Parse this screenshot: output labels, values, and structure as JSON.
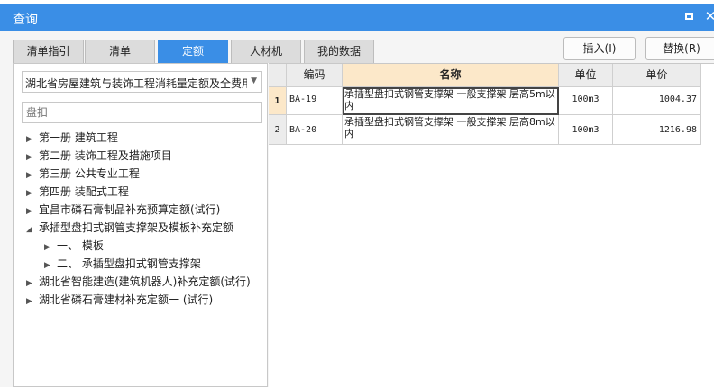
{
  "window": {
    "title": "查询",
    "maximize_label": "□",
    "close_label": "✕"
  },
  "tabs": [
    {
      "label": "清单指引",
      "active": false
    },
    {
      "label": "清单",
      "active": false
    },
    {
      "label": "定额",
      "active": true
    },
    {
      "label": "人材机",
      "active": false
    },
    {
      "label": "我的数据",
      "active": false
    }
  ],
  "actions": {
    "insert_label": "插入(I)",
    "replace_label": "替换(R)"
  },
  "left": {
    "library_select": "湖北省房屋建筑与装饰工程消耗量定额及全费用基价表",
    "search_placeholder": "盘扣",
    "tree": [
      {
        "label": "第一册 建筑工程",
        "expanded": false,
        "level": 0
      },
      {
        "label": "第二册 装饰工程及措施项目",
        "expanded": false,
        "level": 0
      },
      {
        "label": "第三册 公共专业工程",
        "expanded": false,
        "level": 0
      },
      {
        "label": "第四册 装配式工程",
        "expanded": false,
        "level": 0
      },
      {
        "label": "宜昌市磷石膏制品补充预算定额(试行)",
        "expanded": false,
        "level": 0
      },
      {
        "label": "承插型盘扣式钢管支撑架及模板补充定额",
        "expanded": true,
        "level": 0
      },
      {
        "label": "一、 模板",
        "expanded": false,
        "level": 1
      },
      {
        "label": "二、 承插型盘扣式钢管支撑架",
        "expanded": false,
        "level": 1
      },
      {
        "label": "湖北省智能建造(建筑机器人)补充定额(试行)",
        "expanded": false,
        "level": 0
      },
      {
        "label": "湖北省磷石膏建材补充定额一 (试行)",
        "expanded": false,
        "level": 0
      }
    ]
  },
  "grid": {
    "columns": {
      "code": "编码",
      "name": "名称",
      "unit": "单位",
      "price": "单价"
    },
    "rows": [
      {
        "num": "1",
        "code": "BA-19",
        "name": "承插型盘扣式钢管支撑架 一般支撑架 层高5m以内",
        "unit": "100m3",
        "price": "1004.37",
        "selected": true
      },
      {
        "num": "2",
        "code": "BA-20",
        "name": "承插型盘扣式钢管支撑架 一般支撑架 层高8m以内",
        "unit": "100m3",
        "price": "1216.98",
        "selected": false
      }
    ]
  },
  "colors": {
    "titlebar": "#3a8ee6",
    "active_tab": "#3a8ee6",
    "selected_header": "#fce8c9"
  },
  "icons": {
    "collapsed": "caret-right-icon",
    "expanded": "caret-down-icon",
    "dropdown": "chevron-down-icon"
  }
}
